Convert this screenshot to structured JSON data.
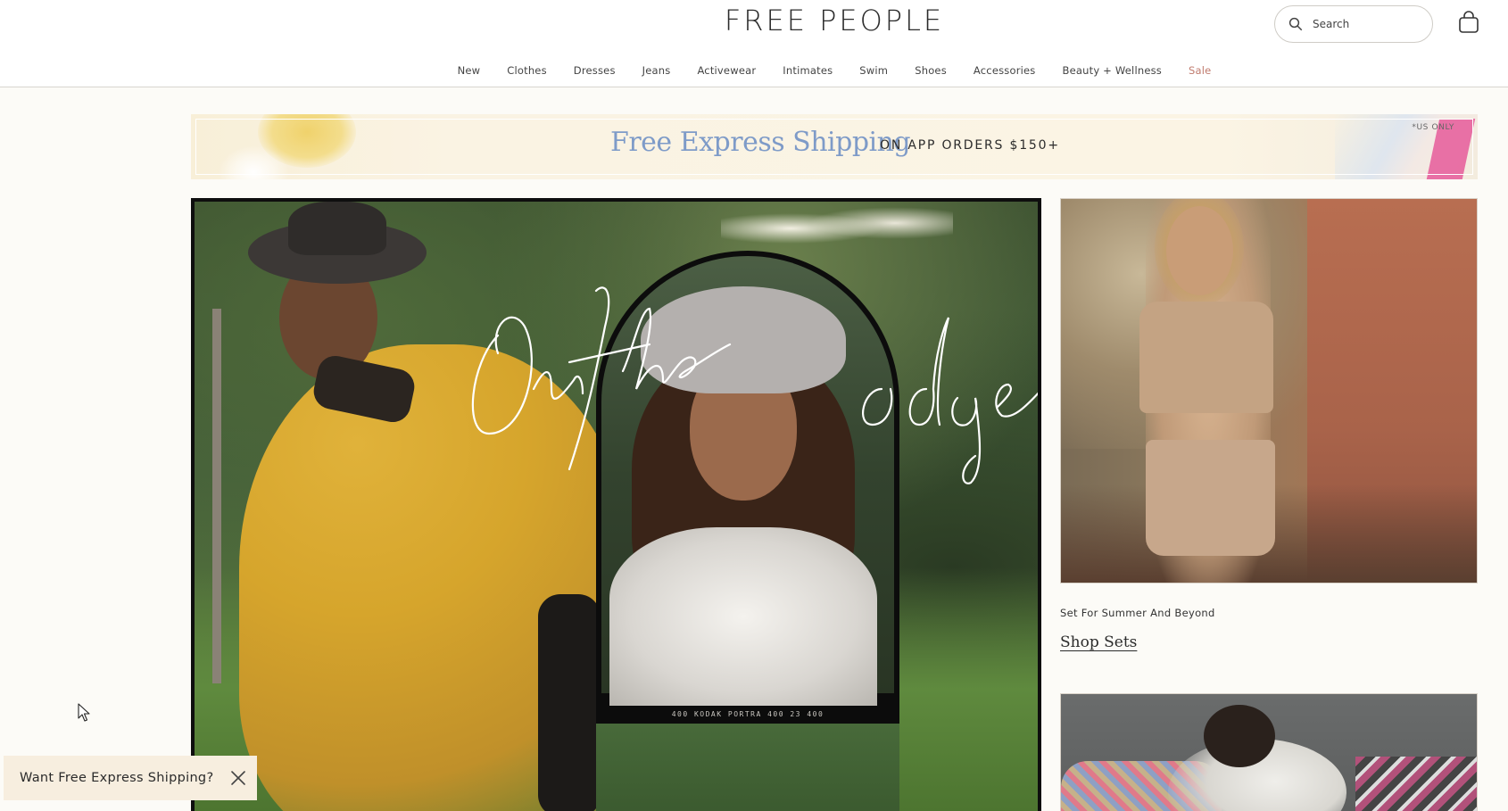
{
  "header": {
    "logo": "FREE PEOPLE",
    "search_placeholder": "Search"
  },
  "nav": {
    "items": [
      "New",
      "Clothes",
      "Dresses",
      "Jeans",
      "Activewear",
      "Intimates",
      "Swim",
      "Shoes",
      "Accessories",
      "Beauty + Wellness",
      "Sale"
    ]
  },
  "banner": {
    "title": "Free Express Shipping",
    "subtitle": "ON APP ORDERS $150+",
    "note": "*US ONLY"
  },
  "hero": {
    "script_text": "On the edge",
    "film_strip": "400   KODAK PORTRA 400   23   400"
  },
  "promo": {
    "caption": "Set For Summer And Beyond",
    "link_label": "Shop Sets"
  },
  "toast": {
    "label": "Want Free Express Shipping?"
  },
  "colors": {
    "sale": "#c07b6e",
    "banner_title": "#7e9bc8",
    "background": "#fcfbf7"
  }
}
